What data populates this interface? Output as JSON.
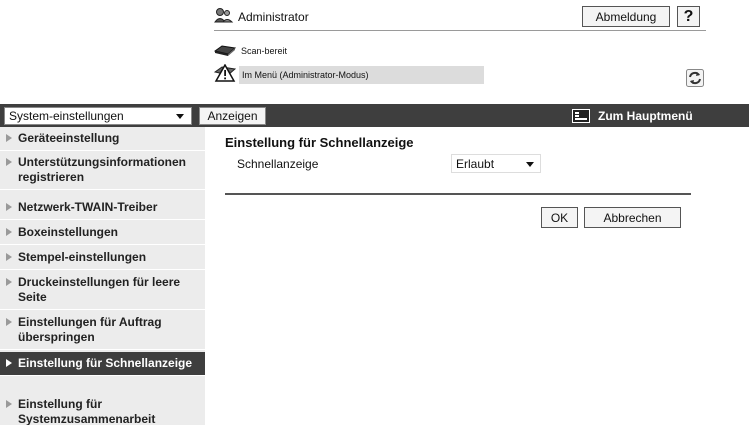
{
  "header": {
    "user": "Administrator",
    "logout_label": "Abmeldung",
    "help_label": "?",
    "status_ready": "Scan-bereit",
    "status_mode": "Im Menü (Administrator-Modus)"
  },
  "nav": {
    "system_select": "System-einstellungen",
    "show_button": "Anzeigen",
    "main_menu": "Zum Hauptmenü"
  },
  "sidebar": {
    "items": [
      {
        "label": "Geräteeinstellung"
      },
      {
        "label": "Unterstützungsinformationen registrieren"
      },
      {
        "label": "Netzwerk-TWAIN-Treiber"
      },
      {
        "label": "Boxeinstellungen"
      },
      {
        "label": "Stempel-einstellungen"
      },
      {
        "label": "Druckeinstellungen für leere Seite"
      },
      {
        "label": "Einstellungen für Auftrag überspringen"
      },
      {
        "label": "Einstellung für Schnellanzeige",
        "active": true
      },
      {
        "label": "Einstellung für Systemzusammenarbeit"
      }
    ]
  },
  "main": {
    "title": "Einstellung für Schnellanzeige",
    "setting_label": "Schnellanzeige",
    "setting_value": "Erlaubt",
    "ok_label": "OK",
    "cancel_label": "Abbrechen"
  }
}
